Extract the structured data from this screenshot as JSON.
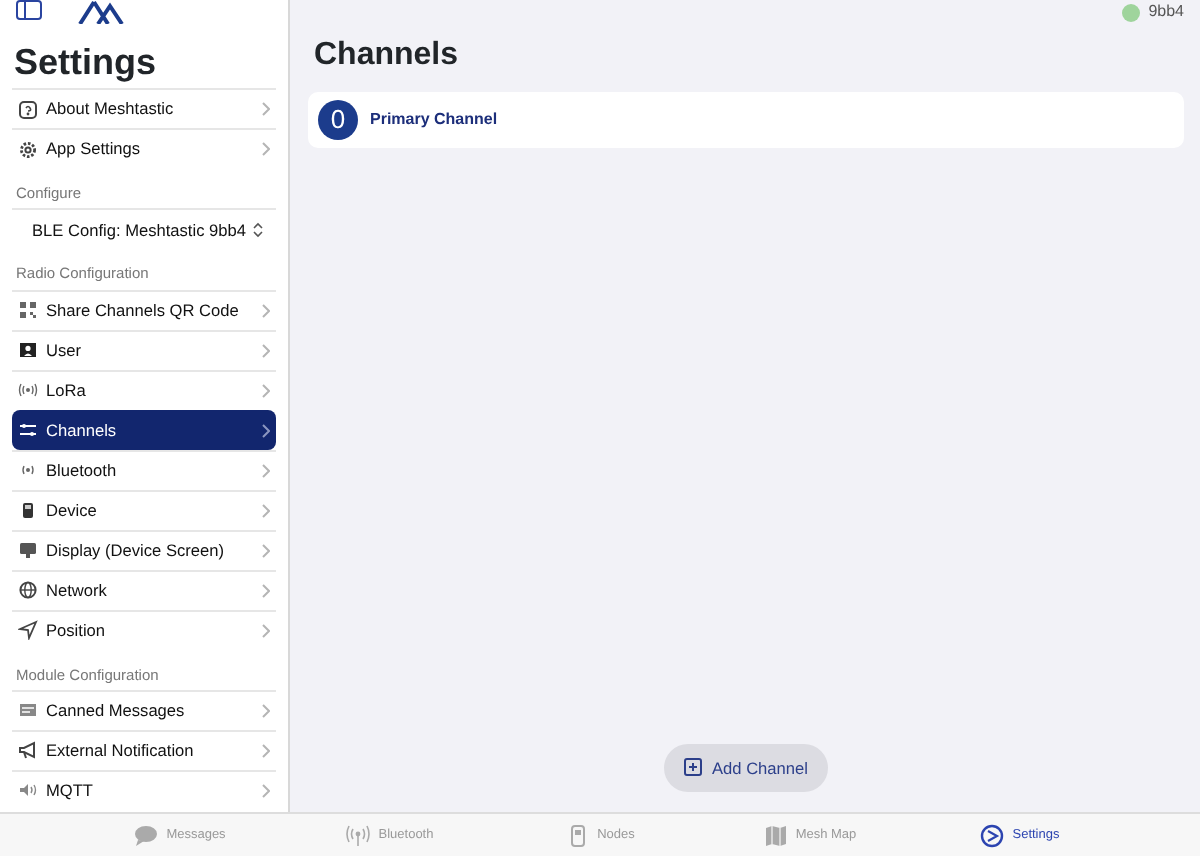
{
  "sidebar": {
    "title": "Settings",
    "groups": [
      {
        "items": [
          {
            "kind": "link",
            "label": "About Meshtastic",
            "selected": false
          },
          {
            "kind": "link",
            "label": "App Settings",
            "selected": false
          }
        ]
      },
      {
        "header": "Configure",
        "items": [
          {
            "kind": "picker",
            "label": "BLE Config: Meshtastic 9bb4",
            "selected": false
          }
        ]
      },
      {
        "header": "Radio Configuration",
        "items": [
          {
            "kind": "link",
            "label": "Share Channels QR Code",
            "selected": false
          },
          {
            "kind": "link",
            "label": "User",
            "selected": false
          },
          {
            "kind": "link",
            "label": "LoRa",
            "selected": false
          },
          {
            "kind": "link",
            "label": "Channels",
            "selected": true
          },
          {
            "kind": "link",
            "label": "Bluetooth",
            "selected": false
          },
          {
            "kind": "link",
            "label": "Device",
            "selected": false
          },
          {
            "kind": "link",
            "label": "Display (Device Screen)",
            "selected": false
          },
          {
            "kind": "link",
            "label": "Network",
            "selected": false
          },
          {
            "kind": "link",
            "label": "Position",
            "selected": false
          }
        ]
      },
      {
        "header": "Module Configuration",
        "items": [
          {
            "kind": "link",
            "label": "Canned Messages",
            "selected": false
          },
          {
            "kind": "link",
            "label": "External Notification",
            "selected": false
          },
          {
            "kind": "link",
            "label": "MQTT",
            "selected": false
          }
        ]
      }
    ]
  },
  "main": {
    "node": "9bb4",
    "title": "Channels",
    "channels": [
      {
        "index": "0",
        "name": "Primary Channel"
      }
    ],
    "add_button": "Add Channel"
  },
  "tabbar": [
    {
      "label": "Messages",
      "selected": false
    },
    {
      "label": "Bluetooth",
      "selected": false
    },
    {
      "label": "Nodes",
      "selected": false
    },
    {
      "label": "Mesh Map",
      "selected": false
    },
    {
      "label": "Settings",
      "selected": true
    }
  ]
}
